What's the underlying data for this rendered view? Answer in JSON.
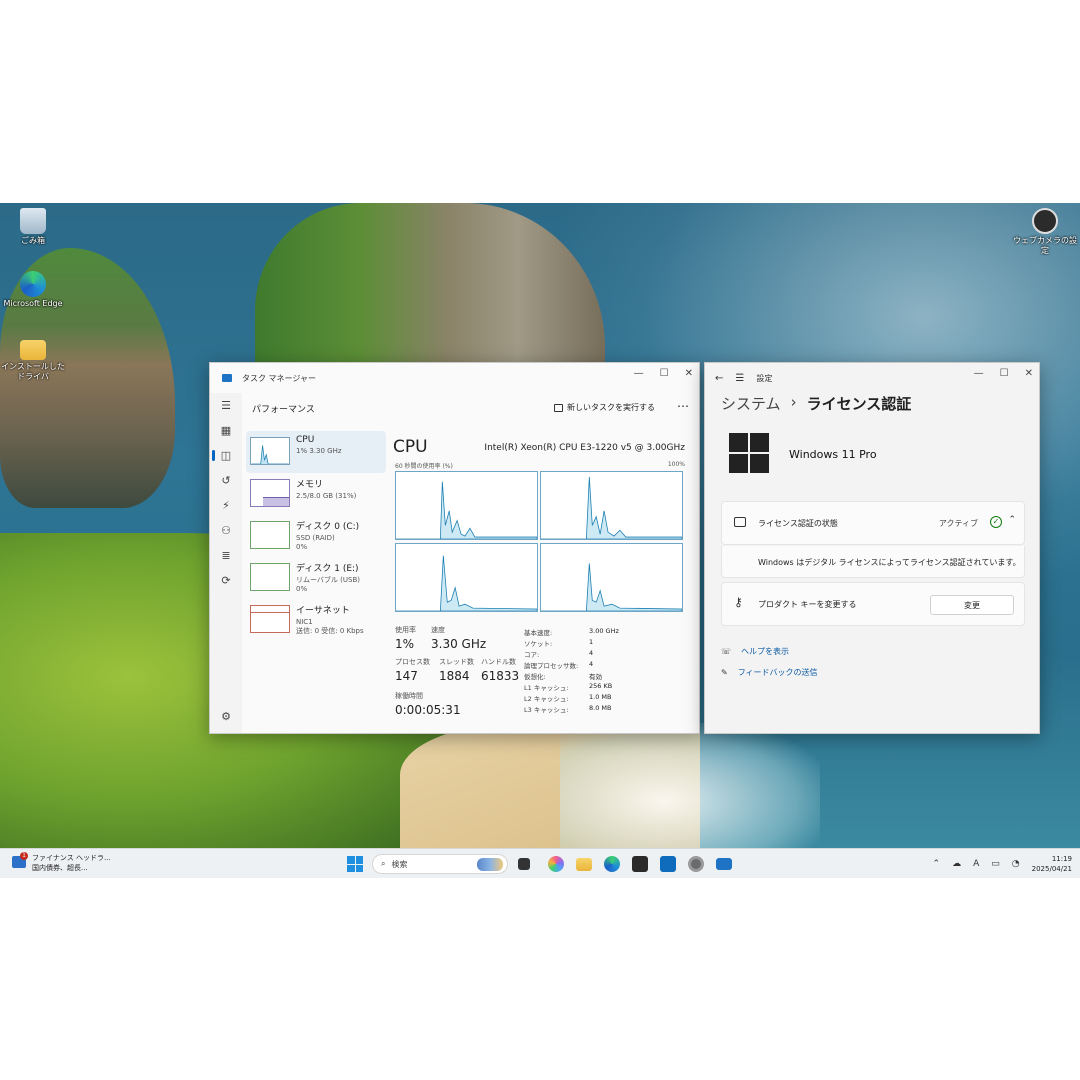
{
  "desktop": {
    "icons": [
      {
        "label": "ごみ箱",
        "icon": "recycle-bin-icon"
      },
      {
        "label": "Microsoft Edge",
        "icon": "edge-icon"
      },
      {
        "label": "インストールしたドライバ",
        "icon": "folder-icon"
      },
      {
        "label": "ウェブカメラの設定",
        "icon": "camera-settings-icon"
      }
    ]
  },
  "taskmgr": {
    "title": "タスク マネージャー",
    "header": "パフォーマンス",
    "run_task": "新しいタスクを実行する",
    "resources": [
      {
        "name": "CPU",
        "sub": "1% 3.30 GHz"
      },
      {
        "name": "メモリ",
        "sub": "2.5/8.0 GB (31%)"
      },
      {
        "name": "ディスク 0 (C:)",
        "sub": "SSD (RAID)",
        "sub2": "0%"
      },
      {
        "name": "ディスク 1 (E:)",
        "sub": "リムーバブル (USB)",
        "sub2": "0%"
      },
      {
        "name": "イーサネット",
        "sub": "NIC1",
        "sub2": "送信: 0 受信: 0 Kbps"
      }
    ],
    "cpu": {
      "title": "CPU",
      "model": "Intel(R) Xeon(R) CPU E3-1220 v5 @ 3.00GHz",
      "graph_label": "60 秒間の使用率 (%)",
      "graph_max": "100%",
      "usage_label": "使用率",
      "usage": "1%",
      "speed_label": "速度",
      "speed": "3.30 GHz",
      "proc_label": "プロセス数",
      "proc": "147",
      "threads_label": "スレッド数",
      "threads": "1884",
      "handles_label": "ハンドル数",
      "handles": "61833",
      "uptime_label": "稼働時間",
      "uptime": "0:00:05:31",
      "details": [
        {
          "k": "基本速度:",
          "v": "3.00 GHz"
        },
        {
          "k": "ソケット:",
          "v": "1"
        },
        {
          "k": "コア:",
          "v": "4"
        },
        {
          "k": "論理プロセッサ数:",
          "v": "4"
        },
        {
          "k": "仮想化:",
          "v": "有効"
        },
        {
          "k": "L1 キャッシュ:",
          "v": "256 KB"
        },
        {
          "k": "L2 キャッシュ:",
          "v": "1.0 MB"
        },
        {
          "k": "L3 キャッシュ:",
          "v": "8.0 MB"
        }
      ]
    }
  },
  "settings": {
    "title": "設定",
    "breadcrumb_parent": "システム",
    "breadcrumb_sep": "›",
    "breadcrumb_current": "ライセンス認証",
    "edition": "Windows 11 Pro",
    "license_state_label": "ライセンス認証の状態",
    "license_state_value": "アクティブ",
    "license_message": "Windows はデジタル ライセンスによってライセンス認証されています。",
    "product_key_label": "プロダクト キーを変更する",
    "change_button": "変更",
    "help_link": "ヘルプを表示",
    "feedback_link": "フィードバックの送信"
  },
  "taskbar": {
    "news_title": "ファイナンス ヘッドラ...",
    "news_sub": "国内債券、超長...",
    "news_badge": "1",
    "search_placeholder": "検索",
    "ime": "A",
    "time": "11:19",
    "date": "2025/04/21"
  }
}
